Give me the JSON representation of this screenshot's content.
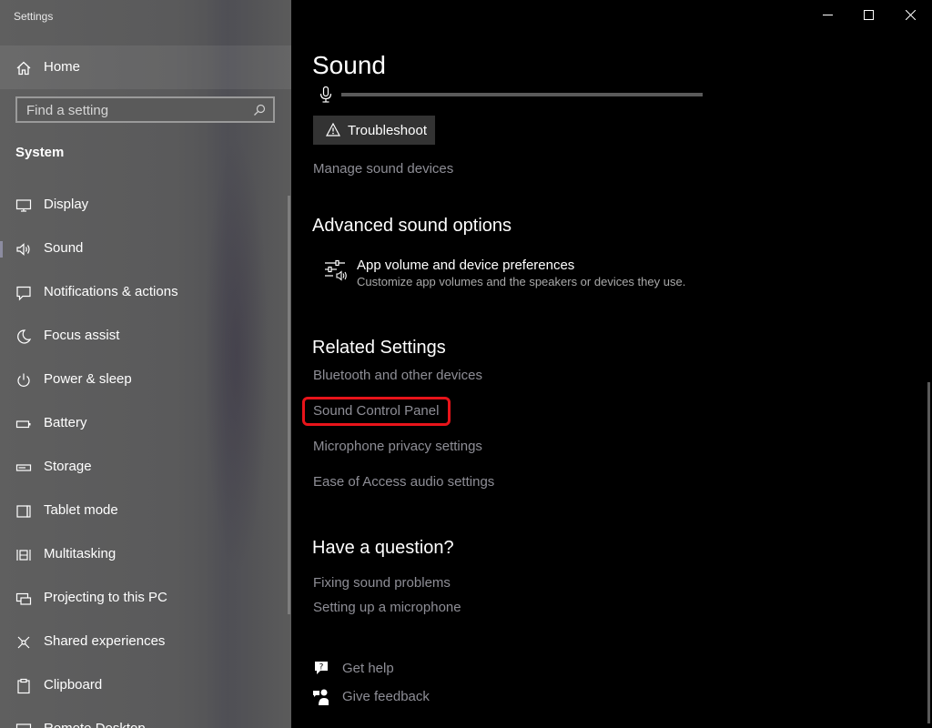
{
  "window": {
    "title": "Settings"
  },
  "sidebar": {
    "home_label": "Home",
    "search_placeholder": "Find a setting",
    "section_label": "System",
    "items": [
      {
        "label": "Display",
        "icon": "display-icon"
      },
      {
        "label": "Sound",
        "icon": "speaker-icon",
        "selected": true
      },
      {
        "label": "Notifications & actions",
        "icon": "notification-icon"
      },
      {
        "label": "Focus assist",
        "icon": "moon-icon"
      },
      {
        "label": "Power & sleep",
        "icon": "power-icon"
      },
      {
        "label": "Battery",
        "icon": "battery-icon"
      },
      {
        "label": "Storage",
        "icon": "storage-icon"
      },
      {
        "label": "Tablet mode",
        "icon": "tablet-icon"
      },
      {
        "label": "Multitasking",
        "icon": "multitasking-icon"
      },
      {
        "label": "Projecting to this PC",
        "icon": "projecting-icon"
      },
      {
        "label": "Shared experiences",
        "icon": "shared-icon"
      },
      {
        "label": "Clipboard",
        "icon": "clipboard-icon"
      },
      {
        "label": "Remote Desktop",
        "icon": "remote-desktop-icon"
      }
    ]
  },
  "main": {
    "title": "Sound",
    "troubleshoot_label": "Troubleshoot",
    "manage_devices_link": "Manage sound devices",
    "advanced": {
      "heading": "Advanced sound options",
      "app_volume_title": "App volume and device preferences",
      "app_volume_desc": "Customize app volumes and the speakers or devices they use."
    },
    "related": {
      "heading": "Related Settings",
      "links": [
        "Bluetooth and other devices",
        "Sound Control Panel",
        "Microphone privacy settings",
        "Ease of Access audio settings"
      ]
    },
    "question": {
      "heading": "Have a question?",
      "links": [
        "Fixing sound problems",
        "Setting up a microphone"
      ]
    },
    "help": {
      "get_help": "Get help",
      "give_feedback": "Give feedback"
    }
  },
  "colors": {
    "highlight": "#e8141a",
    "link": "#8e8e96"
  }
}
